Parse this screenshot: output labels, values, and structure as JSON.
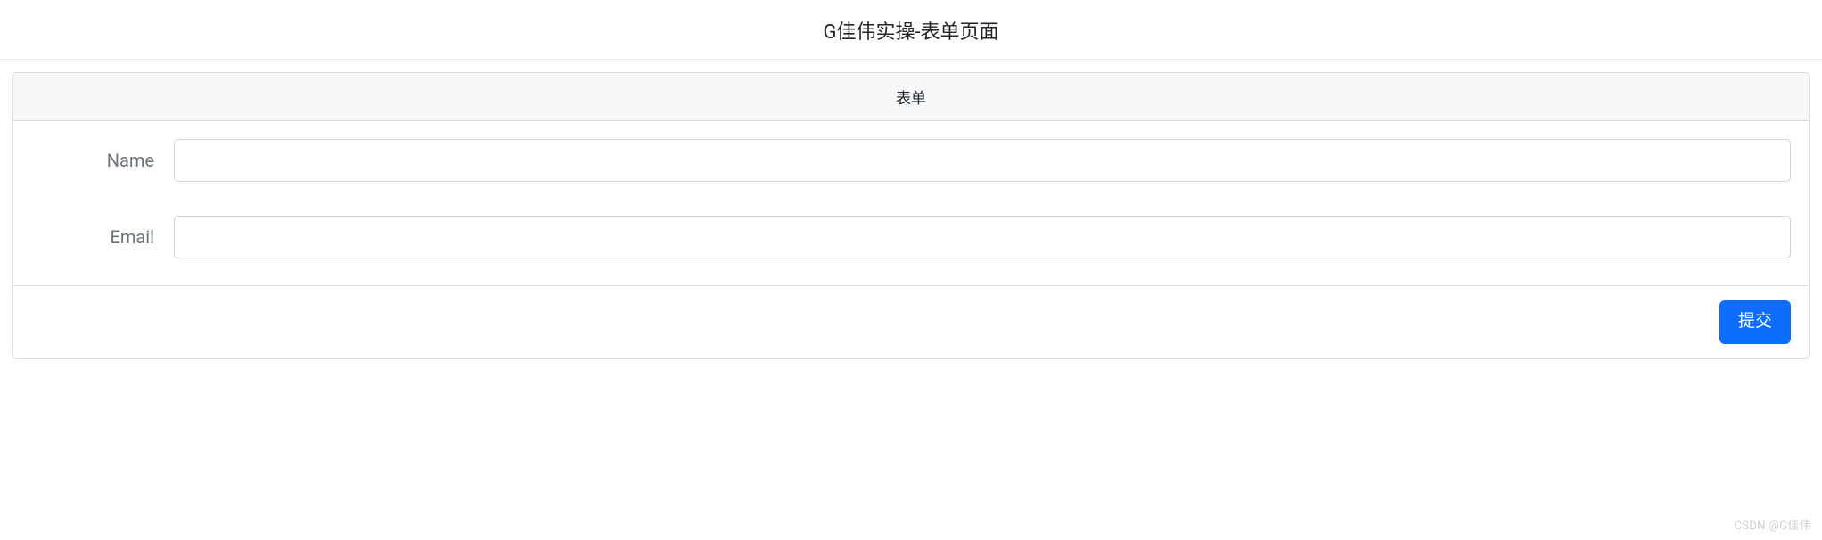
{
  "header": {
    "title": "G佳伟实操-表单页面"
  },
  "card": {
    "header_label": "表单",
    "form": {
      "name": {
        "label": "Name",
        "value": "",
        "placeholder": ""
      },
      "email": {
        "label": "Email",
        "value": "",
        "placeholder": ""
      }
    },
    "submit_label": "提交"
  },
  "watermark": "CSDN @G佳伟"
}
